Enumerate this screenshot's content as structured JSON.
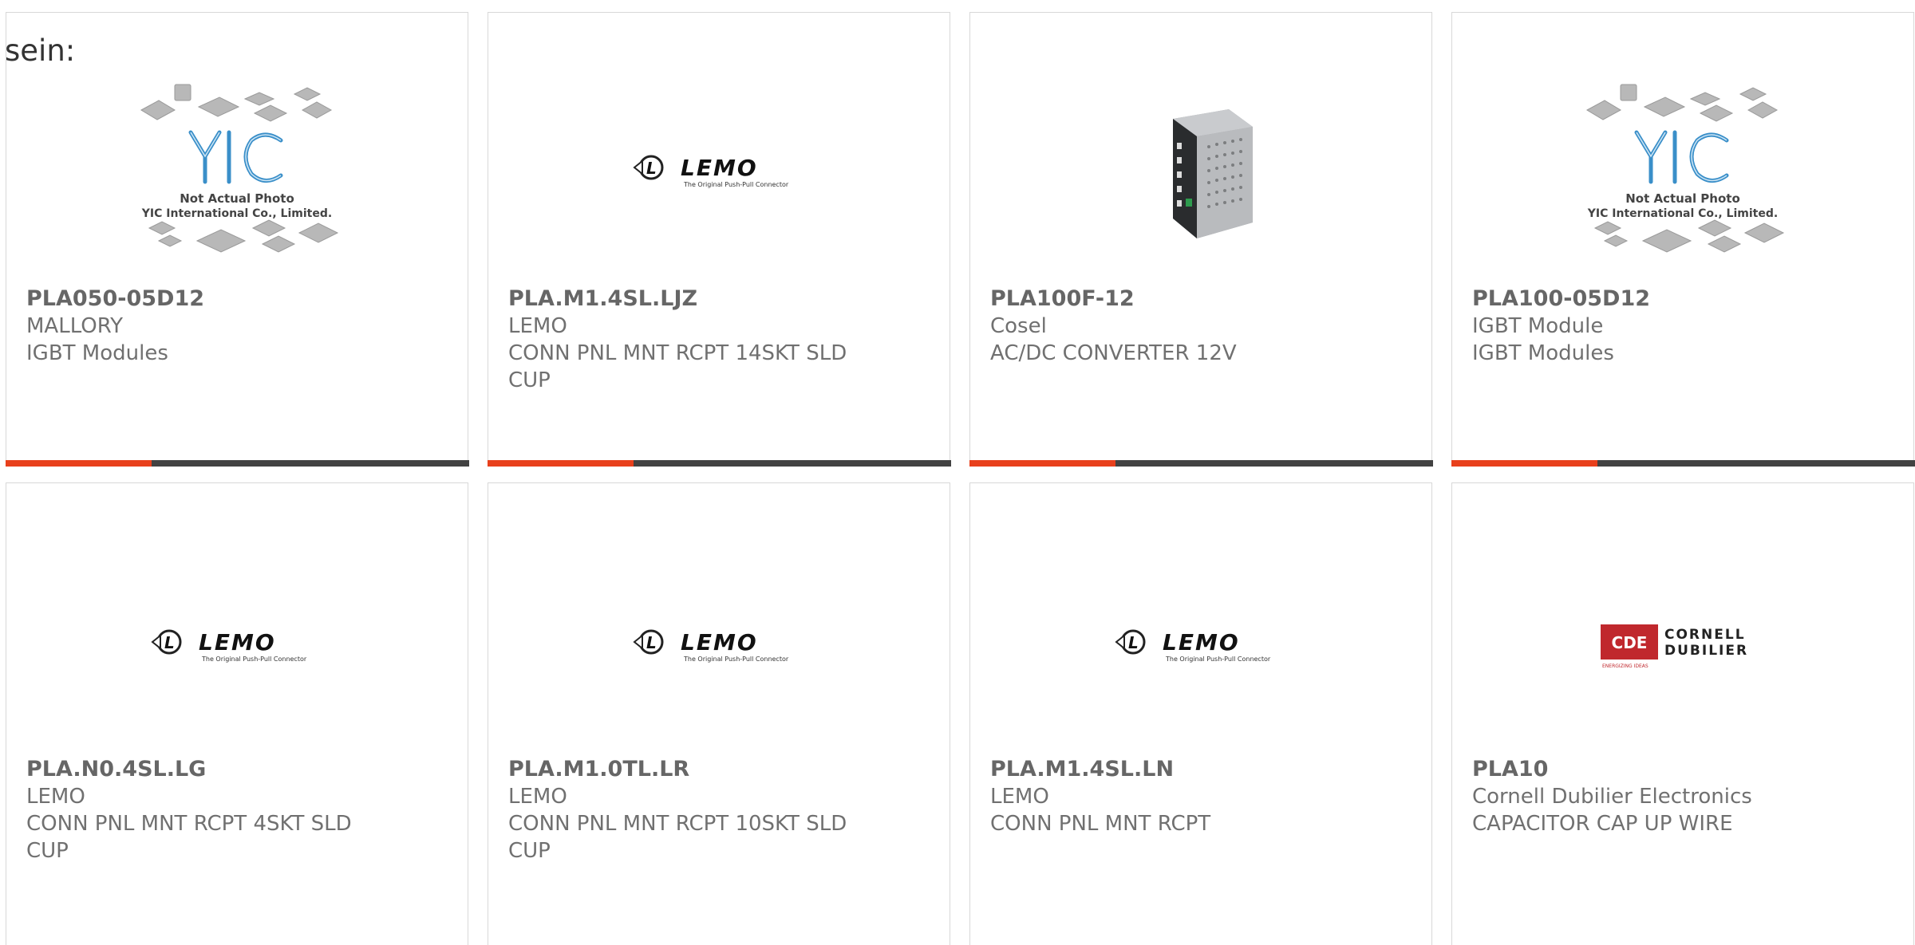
{
  "intro_text": "sein:",
  "placeholder": {
    "line1": "Not Actual Photo",
    "line2": "YIC International Co., Limited."
  },
  "logos": {
    "lemo_name": "LEMO",
    "lemo_tagline": "The Original Push-Pull Connector",
    "cde_badge": "CDE",
    "cde_line1": "CORNELL",
    "cde_line2": "DUBILIER",
    "cde_sub": "ENERGIZING IDEAS"
  },
  "colors": {
    "accent": "#e8401c",
    "bar": "#424242",
    "border": "#d8d8d8",
    "text": "#666666"
  },
  "products": [
    {
      "part": "PLA050-05D12",
      "manufacturer": "MALLORY",
      "description": "IGBT Modules",
      "image": "yic-placeholder"
    },
    {
      "part": "PLA.M1.4SL.LJZ",
      "manufacturer": "LEMO",
      "description": "CONN PNL MNT RCPT 14SKT SLD CUP",
      "image": "lemo-logo"
    },
    {
      "part": "PLA100F-12",
      "manufacturer": "Cosel",
      "description": "AC/DC CONVERTER 12V",
      "image": "power-supply-photo"
    },
    {
      "part": "PLA100-05D12",
      "manufacturer": "IGBT Module",
      "description": "IGBT Modules",
      "image": "yic-placeholder"
    },
    {
      "part": "PLA.N0.4SL.LG",
      "manufacturer": "LEMO",
      "description": "CONN PNL MNT RCPT 4SKT SLD CUP",
      "image": "lemo-logo"
    },
    {
      "part": "PLA.M1.0TL.LR",
      "manufacturer": "LEMO",
      "description": "CONN PNL MNT RCPT 10SKT SLD CUP",
      "image": "lemo-logo"
    },
    {
      "part": "PLA.M1.4SL.LN",
      "manufacturer": "LEMO",
      "description": "CONN PNL MNT RCPT",
      "image": "lemo-logo"
    },
    {
      "part": "PLA10",
      "manufacturer": "Cornell Dubilier Electronics",
      "description": "CAPACITOR CAP UP WIRE",
      "image": "cde-logo"
    }
  ]
}
